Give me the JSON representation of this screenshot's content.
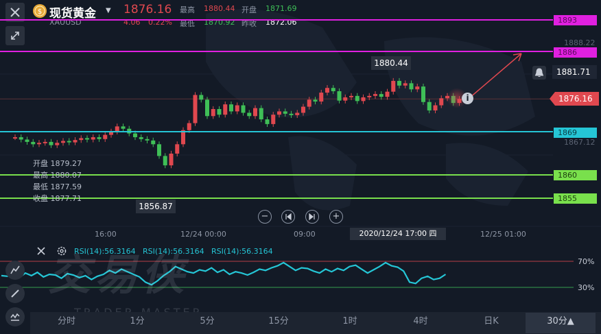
{
  "header": {
    "title": "现货黄金",
    "symbol": "XAUUSD",
    "price": "1876.16",
    "change": "4.06",
    "change_pct": "0.22%",
    "high_label": "最高",
    "high": "1880.44",
    "low_label": "最低",
    "low": "1870.92",
    "open_label": "开盘",
    "open": "1871.69",
    "prev_close_label": "昨收",
    "prev_close": "1872.06"
  },
  "price_axis": {
    "tick_1893": "1893",
    "tick_1888": "1888.22",
    "tick_1886": "1886",
    "tick_1881": "1881.71",
    "tick_1876": "1876.16",
    "tick_1869": "1869",
    "tick_1867": "1867.12",
    "tick_1860": "1860",
    "tick_1855": "1855"
  },
  "annotations": {
    "high_marker": "1880.44",
    "low_marker": "1856.87"
  },
  "ohlc_tooltip": {
    "open_label": "开盘",
    "open": "1879.27",
    "high_label": "最高",
    "high": "1880.07",
    "low_label": "最低",
    "low": "1877.59",
    "close_label": "收盘",
    "close": "1877.71"
  },
  "time_axis": {
    "t1": "16:00",
    "t2": "12/24 00:00",
    "t3": "09:00",
    "crosshair": "2020/12/24 17:00 四",
    "t5": "12/25 01:00"
  },
  "rsi": {
    "label1": "RSI(14):56.3164",
    "label2": "RSI(14):56.3164",
    "label3": "RSI(14):56.3164",
    "level_70": "70%",
    "level_30": "30%"
  },
  "watermark": {
    "cn": "交易侠",
    "en": "TRADER MASTER"
  },
  "timeframes": [
    "分时",
    "1分",
    "5分",
    "15分",
    "1时",
    "4时",
    "日K",
    "30分▲"
  ],
  "colors": {
    "up": "#e0484f",
    "down": "#3fbf57",
    "magenta": "#e020e0",
    "cyan": "#25c6d6",
    "green_line": "#79e04c",
    "bg": "#131a26"
  },
  "icons": [
    "close-icon",
    "collapse-icon",
    "bell-icon",
    "info-icon",
    "zoom-out-icon",
    "prev-icon",
    "next-icon",
    "zoom-in-icon",
    "settings-icon",
    "pen-icon",
    "indicator-icon"
  ]
}
